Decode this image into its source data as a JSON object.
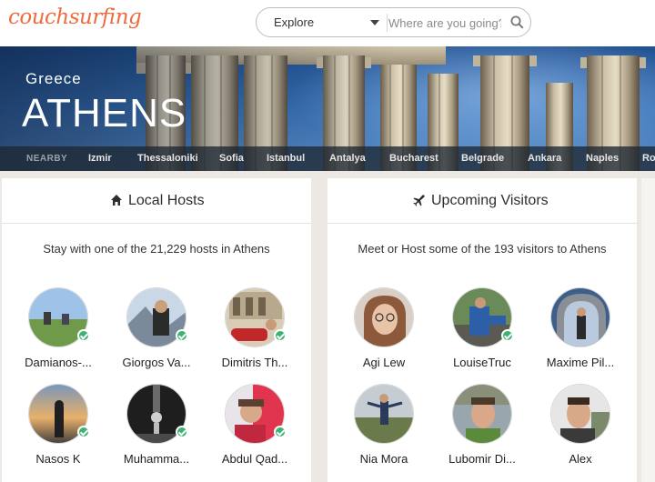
{
  "header": {
    "logo": "couchsurfing",
    "search_mode": "Explore",
    "search_placeholder": "Where are you going?"
  },
  "hero": {
    "country": "Greece",
    "city": "ATHENS",
    "nearby_label": "NEARBY",
    "nearby": [
      "Izmir",
      "Thessaloniki",
      "Sofia",
      "Istanbul",
      "Antalya",
      "Bucharest",
      "Belgrade",
      "Ankara",
      "Naples",
      "Ro"
    ]
  },
  "local_hosts": {
    "title": "Local Hosts",
    "subtitle": "Stay with one of the 21,229 hosts in Athens",
    "people": [
      {
        "name": "Damianos-...",
        "verified": true
      },
      {
        "name": "Giorgos Va...",
        "verified": true
      },
      {
        "name": "Dimitris Th...",
        "verified": true
      },
      {
        "name": "Nasos K",
        "verified": true
      },
      {
        "name": "Muhamma...",
        "verified": true
      },
      {
        "name": "Abdul Qad...",
        "verified": true
      }
    ]
  },
  "visitors": {
    "title": "Upcoming Visitors",
    "subtitle": "Meet or Host some of the 193 visitors to Athens",
    "people": [
      {
        "name": "Agi Lew",
        "verified": false
      },
      {
        "name": "LouiseTruc",
        "verified": true
      },
      {
        "name": "Maxime Pil...",
        "verified": false
      },
      {
        "name": "Nia Mora",
        "verified": false
      },
      {
        "name": "Lubomir Di...",
        "verified": false
      },
      {
        "name": "Alex",
        "verified": false
      }
    ]
  },
  "colors": {
    "brand": "#ed6b3f",
    "verified": "#3cb371"
  }
}
